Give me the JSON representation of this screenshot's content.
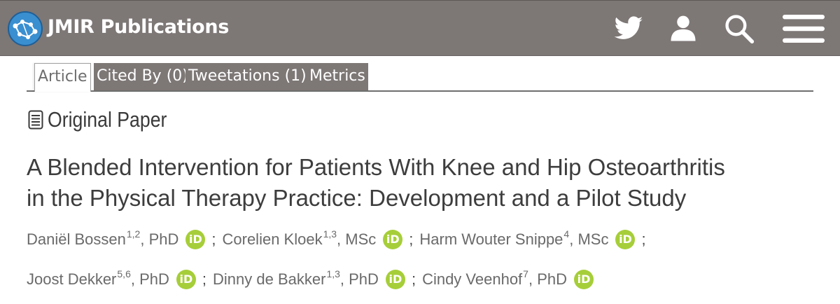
{
  "header": {
    "brand": "JMIR Publications",
    "icons": [
      "twitter-icon",
      "user-icon",
      "search-icon",
      "menu-icon"
    ]
  },
  "tabs": [
    {
      "label": "Article",
      "active": true
    },
    {
      "label": "Cited By (0)",
      "active": false
    },
    {
      "label": "Tweetations (1)",
      "active": false
    },
    {
      "label": "Metrics",
      "active": false
    }
  ],
  "article": {
    "type": "Original Paper",
    "title_line1": "A Blended Intervention for Patients With Knee and Hip Osteoarthritis",
    "title_line2": "in the Physical Therapy Practice: Development and a Pilot Study",
    "orcid_label": "iD",
    "separator": ";",
    "authors": [
      {
        "name": "Daniël Bossen",
        "aff": "1,2",
        "degree": ", PhD"
      },
      {
        "name": "Corelien Kloek",
        "aff": "1,3",
        "degree": ", MSc"
      },
      {
        "name": "Harm Wouter Snippe",
        "aff": "4",
        "degree": ", MSc"
      },
      {
        "name": "Joost Dekker",
        "aff": "5,6",
        "degree": ", PhD"
      },
      {
        "name": "Dinny de Bakker",
        "aff": "1,3",
        "degree": ", PhD"
      },
      {
        "name": "Cindy Veenhof",
        "aff": "7",
        "degree": ", PhD"
      }
    ]
  },
  "colors": {
    "header_bg": "#7d7776",
    "orcid_green": "#a6ce39",
    "text_dark": "#3d3d3d",
    "text_muted": "#6a6a6a"
  }
}
